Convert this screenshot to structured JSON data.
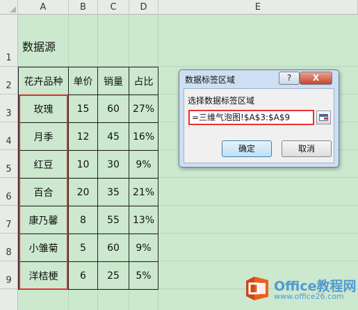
{
  "columns": [
    "A",
    "B",
    "C",
    "D",
    "E"
  ],
  "rows": [
    "1",
    "2",
    "3",
    "4",
    "5",
    "6",
    "7",
    "8",
    "9"
  ],
  "sheet": {
    "title": "数据源",
    "headers": [
      "花卉品种",
      "单价",
      "销量",
      "占比"
    ],
    "data": [
      [
        "玫瑰",
        "15",
        "60",
        "27%"
      ],
      [
        "月季",
        "12",
        "45",
        "16%"
      ],
      [
        "红豆",
        "10",
        "30",
        "9%"
      ],
      [
        "百合",
        "20",
        "35",
        "21%"
      ],
      [
        "康乃馨",
        "8",
        "55",
        "13%"
      ],
      [
        "小雏菊",
        "5",
        "60",
        "9%"
      ],
      [
        "洋桔梗",
        "6",
        "25",
        "5%"
      ]
    ]
  },
  "dialog": {
    "title": "数据标签区域",
    "help": "?",
    "close": "X",
    "label": "选择数据标签区域",
    "range_value": "=三维气泡图!$A$3:$A$9",
    "ok": "确定",
    "cancel": "取消"
  },
  "watermark": {
    "name": "Office教程网",
    "url": "www.office26.com"
  },
  "colors": {
    "accent_red": "#e8302c",
    "grid_bg": "#cce8cf",
    "logo_orange": "#e8611e",
    "watermark_blue": "#4f9ad6"
  }
}
